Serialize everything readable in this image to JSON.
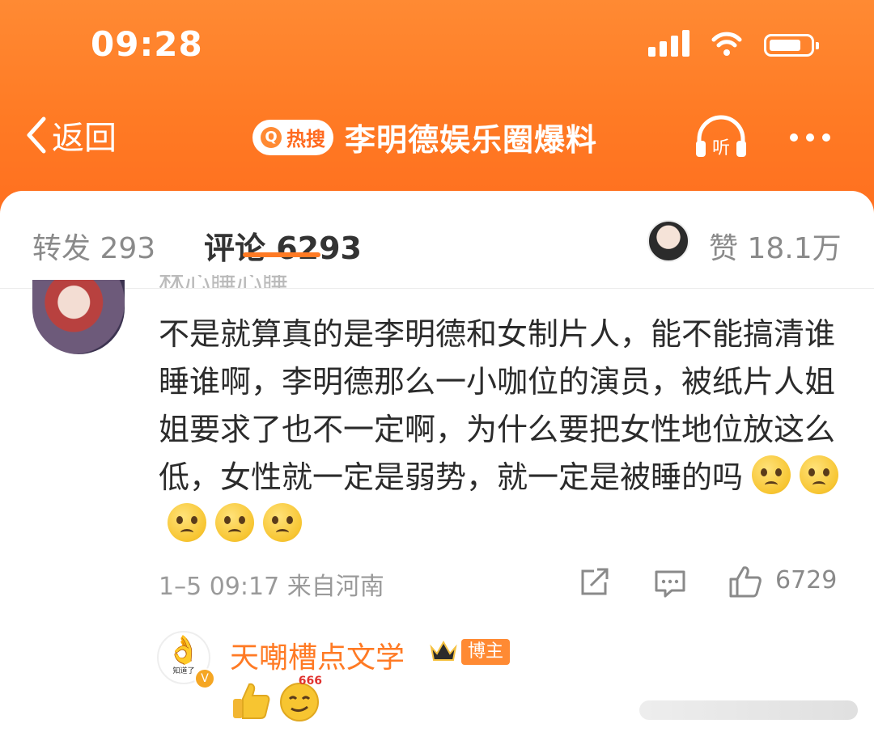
{
  "status_bar": {
    "time": "09:28"
  },
  "header": {
    "back_label": "返回",
    "hot_badge": "热搜",
    "title": "李明德娱乐圈爆料",
    "listen_label": "听"
  },
  "tabs": {
    "repost": "转发 293",
    "comment": "评论 6293",
    "like": "赞 18.1万"
  },
  "comment": {
    "truncated_name": "林心睡心睡",
    "text": "不是就算真的是李明德和女制片人，能不能搞清谁睡谁啊，李明德那么一小咖位的演员，被纸片人姐姐要求了也不一定啊，为什么要把女性地位放这么低，女性就一定是弱势，就一定是被睡的吗",
    "emoji_count": 5,
    "meta": "1–5 09:17 来自河南",
    "like_count": "6729"
  },
  "reply": {
    "avatar_caption": "知道了",
    "name": "天嘲槽点文学",
    "badge": "博主",
    "emoji_tag": "666"
  },
  "colors": {
    "accent": "#ff7a24",
    "header_bg": "#ff8a33"
  }
}
